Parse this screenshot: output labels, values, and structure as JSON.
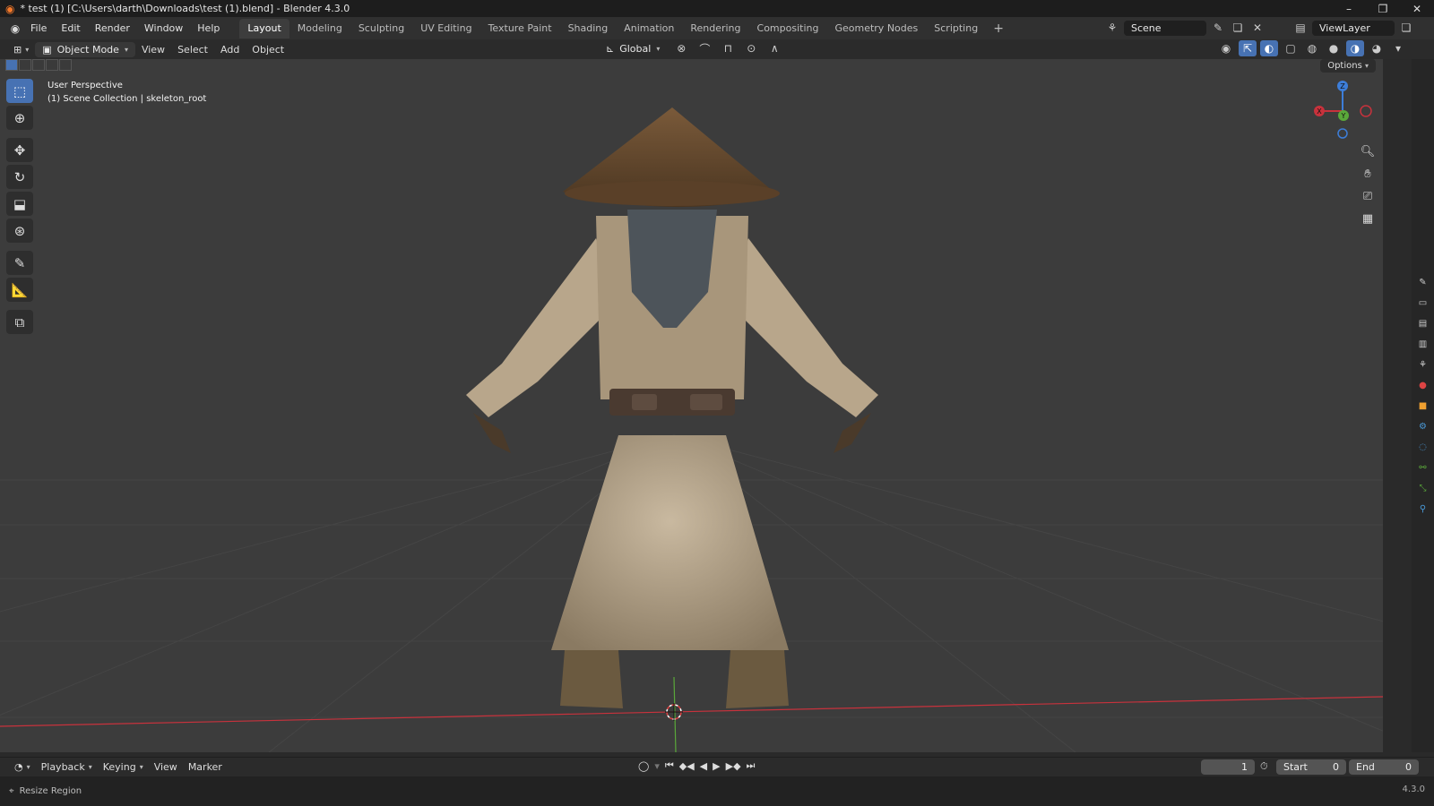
{
  "window": {
    "title": "* test (1) [C:\\Users\\darth\\Downloads\\test (1).blend] - Blender 4.3.0",
    "controls": [
      "–",
      "❐",
      "✕"
    ]
  },
  "menu": {
    "items": [
      "File",
      "Edit",
      "Render",
      "Window",
      "Help"
    ]
  },
  "workspaces": {
    "tabs": [
      "Layout",
      "Modeling",
      "Sculpting",
      "UV Editing",
      "Texture Paint",
      "Shading",
      "Animation",
      "Rendering",
      "Compositing",
      "Geometry Nodes",
      "Scripting"
    ],
    "active": "Layout",
    "add_label": "+"
  },
  "scene": {
    "name": "Scene"
  },
  "view_layer": {
    "name": "ViewLayer"
  },
  "header": {
    "mode": "Object Mode",
    "menus": [
      "View",
      "Select",
      "Add",
      "Object"
    ],
    "transform_orientation": "Global",
    "options_label": "Options"
  },
  "viewport": {
    "view_name": "User Perspective",
    "collection_info": "(1) Scene Collection | skeleton_root",
    "background": "#3c3c3c",
    "axis_x_color": "#c8323c",
    "axis_y_color": "#5aa83a",
    "gizmo_labels": {
      "x": "X",
      "y": "Y",
      "z": "Z"
    }
  },
  "toolbar": {
    "tools": [
      "select-box",
      "cursor",
      "move",
      "rotate",
      "scale",
      "transform",
      "annotate",
      "measure",
      "add-cube"
    ],
    "active": "select-box"
  },
  "timeline": {
    "menus": [
      "Playback",
      "Keying",
      "View",
      "Marker"
    ],
    "current_frame": "1",
    "start_label": "Start",
    "start_value": "0",
    "end_label": "End",
    "end_value": "0"
  },
  "status": {
    "hint": "Resize Region",
    "version": "4.3.0"
  },
  "accent_color": "#4772b3"
}
